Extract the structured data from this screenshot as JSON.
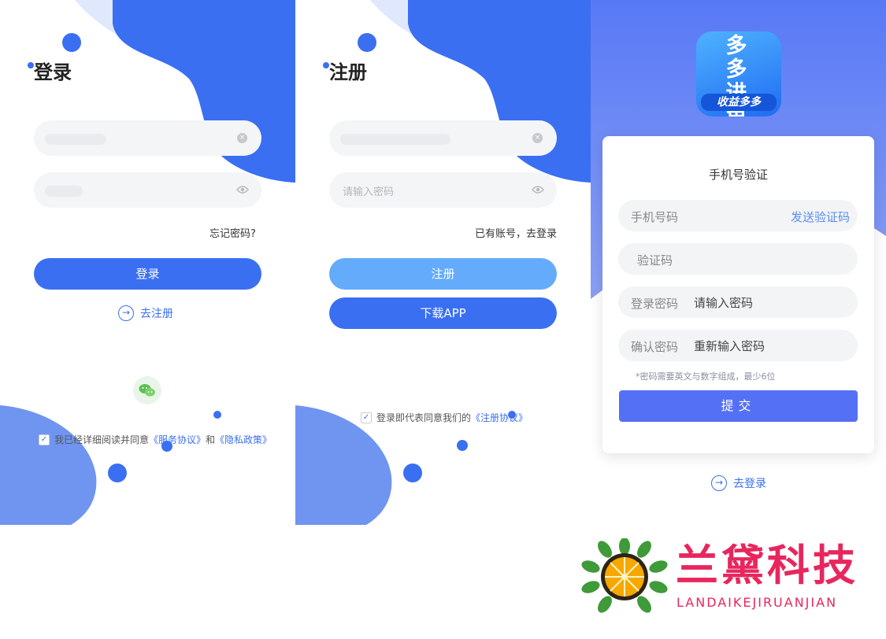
{
  "login": {
    "title": "登录",
    "forgot": "忘记密码?",
    "button": "登录",
    "go_register": "去注册",
    "agree": {
      "prefix": "我已经详细阅读并同意",
      "service": "《服务协议》",
      "and": "和",
      "privacy": "《隐私政策》"
    }
  },
  "register": {
    "title": "注册",
    "password_placeholder": "请输入密码",
    "have_account": "已有账号，去登录",
    "button": "注册",
    "download": "下载APP",
    "agree": {
      "prefix": "登录即代表同意我们的",
      "protocol": "《注册协议》"
    }
  },
  "verify": {
    "app_logo_text": "多多进鱼",
    "app_logo_slogan": "收益多多",
    "title": "手机号验证",
    "phone_label": "手机号码",
    "send_code": "发送验证码",
    "code_label": "验证码",
    "password_label": "登录密码",
    "password_placeholder": "请输入密码",
    "confirm_label": "确认密码",
    "confirm_placeholder": "重新输入密码",
    "hint": "*密码需要英文与数字组成，最少6位",
    "submit": "提交",
    "go_login": "去登录"
  },
  "watermark": {
    "name": "兰黛科技",
    "pinyin": "LANDAIKEJIRUANJIAN"
  },
  "colors": {
    "primary": "#3a6ff2",
    "light_primary": "#64abfb",
    "submit": "#5470f5",
    "watermark": "#e8265e"
  }
}
